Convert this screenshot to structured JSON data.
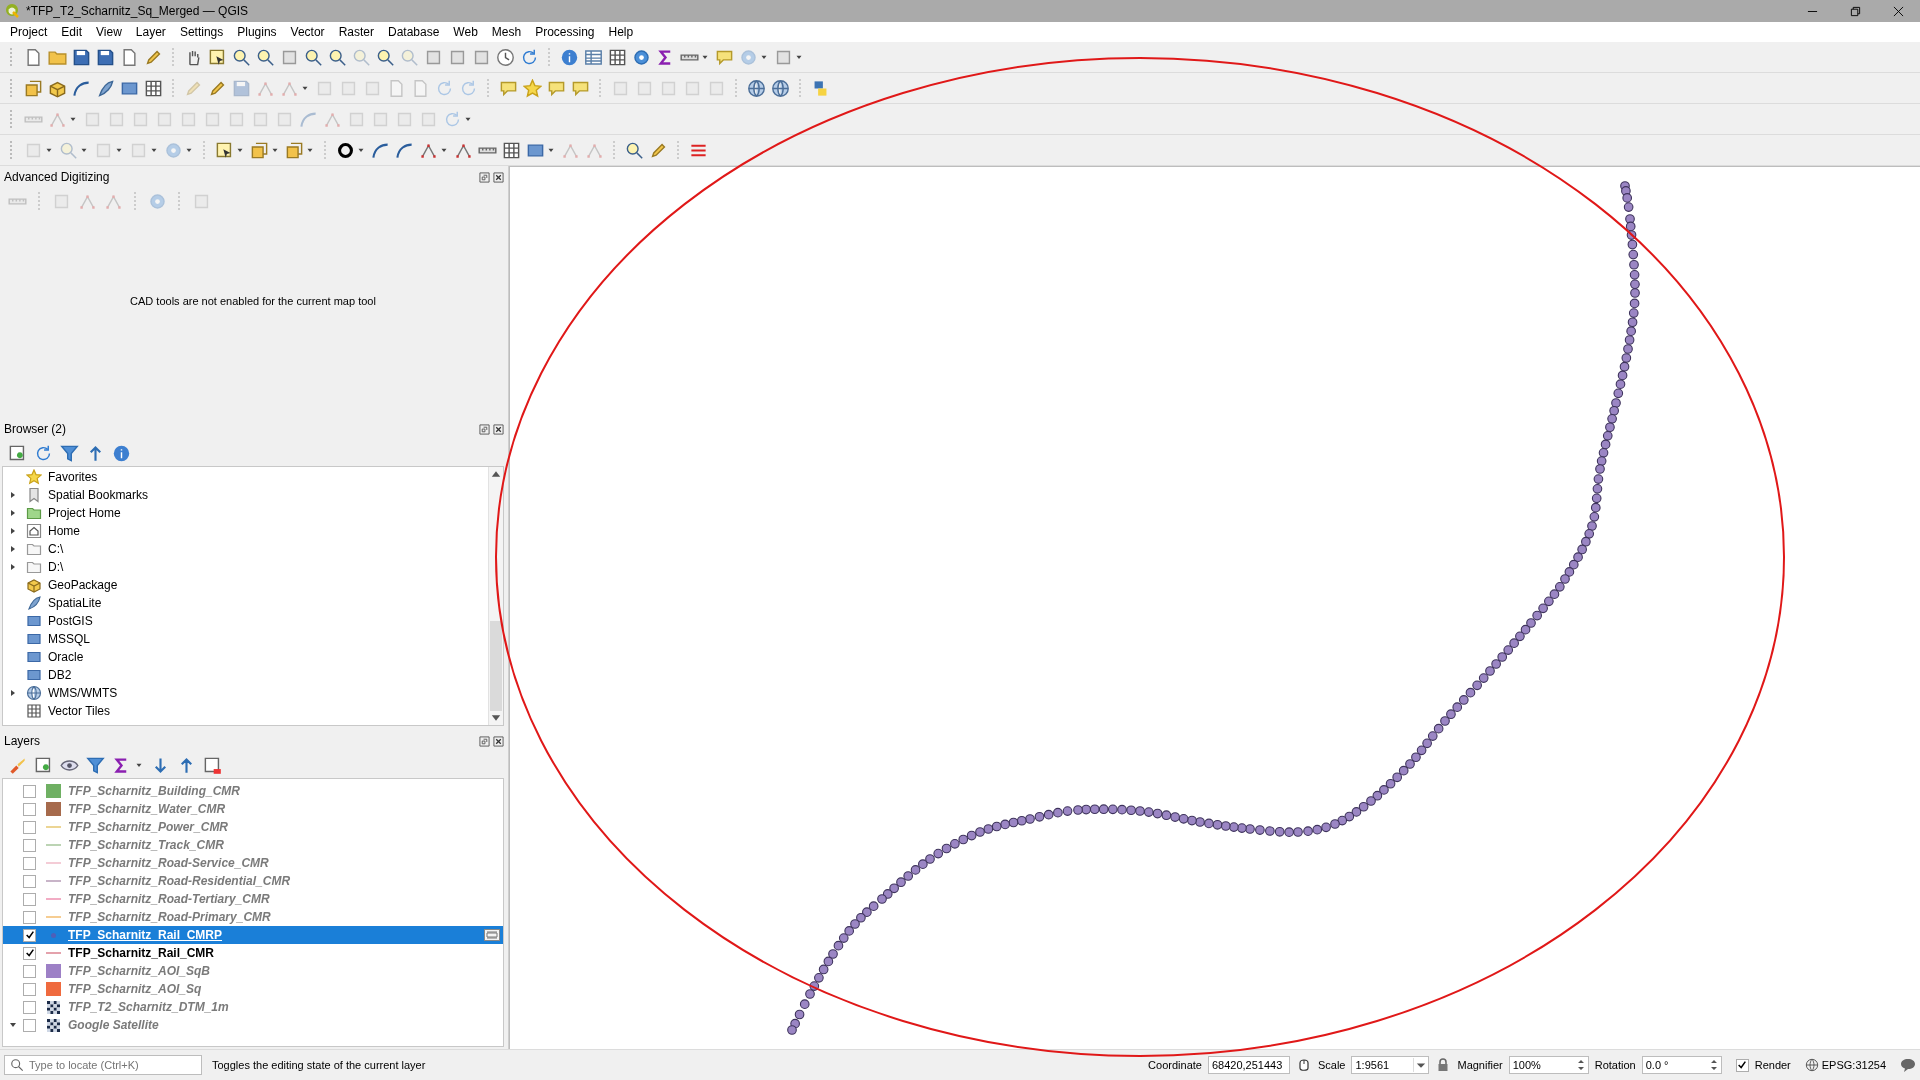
{
  "window": {
    "title": "*TFP_T2_Scharnitz_Sq_Merged — QGIS"
  },
  "menu": [
    "Project",
    "Edit",
    "View",
    "Layer",
    "Settings",
    "Plugins",
    "Vector",
    "Raster",
    "Database",
    "Web",
    "Mesh",
    "Processing",
    "Help"
  ],
  "advanced_digitizing": {
    "title": "Advanced Digitizing",
    "message": "CAD tools are not enabled for the current map tool"
  },
  "browser": {
    "title": "Browser (2)",
    "items": [
      {
        "label": "Favorites",
        "expandable": false
      },
      {
        "label": "Spatial Bookmarks",
        "expandable": true
      },
      {
        "label": "Project Home",
        "expandable": true
      },
      {
        "label": "Home",
        "expandable": true
      },
      {
        "label": "C:\\",
        "expandable": true
      },
      {
        "label": "D:\\",
        "expandable": true
      },
      {
        "label": "GeoPackage",
        "expandable": false
      },
      {
        "label": "SpatiaLite",
        "expandable": false
      },
      {
        "label": "PostGIS",
        "expandable": false
      },
      {
        "label": "MSSQL",
        "expandable": false
      },
      {
        "label": "Oracle",
        "expandable": false
      },
      {
        "label": "DB2",
        "expandable": false
      },
      {
        "label": "WMS/WMTS",
        "expandable": true
      },
      {
        "label": "Vector Tiles",
        "expandable": false
      }
    ]
  },
  "layers": {
    "title": "Layers",
    "items": [
      {
        "name": "TFP_Scharnitz_Building_CMR",
        "checked": false,
        "selected": false,
        "editing": false,
        "kind": "fill",
        "color": "#6fb063"
      },
      {
        "name": "TFP_Scharnitz_Water_CMR",
        "checked": false,
        "selected": false,
        "editing": false,
        "kind": "fill",
        "color": "#a66a4c"
      },
      {
        "name": "TFP_Scharnitz_Power_CMR",
        "checked": false,
        "selected": false,
        "editing": false,
        "kind": "line",
        "color": "#ecd594"
      },
      {
        "name": "TFP_Scharnitz_Track_CMR",
        "checked": false,
        "selected": false,
        "editing": false,
        "kind": "line",
        "color": "#bcd4b4"
      },
      {
        "name": "TFP_Scharnitz_Road-Service_CMR",
        "checked": false,
        "selected": false,
        "editing": false,
        "kind": "line",
        "color": "#f4ccd6"
      },
      {
        "name": "TFP_Scharnitz_Road-Residential_CMR",
        "checked": false,
        "selected": false,
        "editing": false,
        "kind": "line",
        "color": "#c8b4c8"
      },
      {
        "name": "TFP_Scharnitz_Road-Tertiary_CMR",
        "checked": false,
        "selected": false,
        "editing": false,
        "kind": "line",
        "color": "#f2acc4"
      },
      {
        "name": "TFP_Scharnitz_Road-Primary_CMR",
        "checked": false,
        "selected": false,
        "editing": false,
        "kind": "line",
        "color": "#f6cd92"
      },
      {
        "name": "TFP_Scharnitz_Rail_CMRP",
        "checked": true,
        "selected": true,
        "editing": true,
        "kind": "point",
        "color": "#4f5fb8"
      },
      {
        "name": "TFP_Scharnitz_Rail_CMR",
        "checked": true,
        "selected": false,
        "editing": false,
        "kind": "line",
        "color": "#e4a2ac"
      },
      {
        "name": "TFP_Scharnitz_AOI_SqB",
        "checked": false,
        "selected": false,
        "editing": false,
        "kind": "fill",
        "color": "#9d80c6"
      },
      {
        "name": "TFP_Scharnitz_AOI_Sq",
        "checked": false,
        "selected": false,
        "editing": false,
        "kind": "fill",
        "color": "#ef6a3e"
      },
      {
        "name": "TFP_T2_Scharnitz_DTM_1m",
        "checked": false,
        "selected": false,
        "editing": false,
        "kind": "raster"
      },
      {
        "name": "Google Satellite",
        "checked": false,
        "selected": false,
        "editing": false,
        "kind": "raster",
        "expanded": true
      }
    ]
  },
  "status_bar": {
    "locator_placeholder": "Type to locate (Ctrl+K)",
    "message": "Toggles the editing state of the current layer",
    "coordinate_label": "Coordinate",
    "coordinate": "68420,251443",
    "scale_label": "Scale",
    "scale": "1:9561",
    "magnifier_label": "Magnifier",
    "magnifier": "100%",
    "rotation_label": "Rotation",
    "rotation": "0.0 °",
    "render": {
      "label": "Render",
      "checked": true
    },
    "crs": "EPSG:31254"
  }
}
